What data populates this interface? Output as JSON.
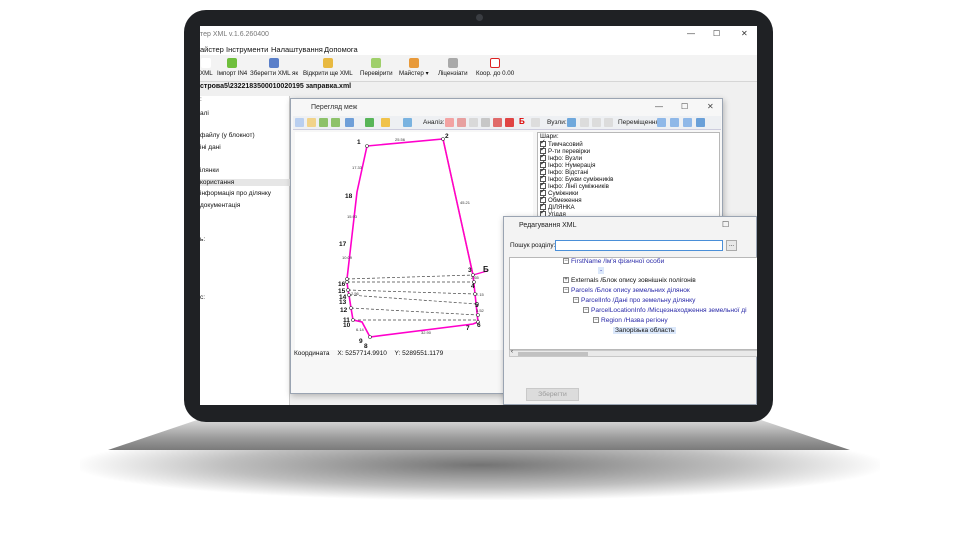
{
  "app": {
    "title": "тер XML v.1.6.260400",
    "menu": [
      "айстер",
      "Інструменти",
      "Налаштування",
      "Допомога"
    ],
    "toolbar": [
      "XML",
      "Імпорт IN4",
      "Зберегти XML як",
      "Відкрити ще XML",
      "Перевірити",
      "Майстер",
      "Ліцензіати",
      "Коор. до 0.00"
    ],
    "path": "строва5\\2322183500010020195 заправка.xml",
    "left_items": [
      ":",
      "алі",
      "файлу (у блокнот)",
      "іні дані",
      "ілянки",
      "користання",
      "інформація про ділянку",
      "документація",
      "ь:",
      "с:"
    ]
  },
  "map_window": {
    "title": "Перегляд меж",
    "analysis_label": "Аналіз:",
    "nodes_label": "Вузли:",
    "moves_label": "Переміщення:",
    "layers_header": "Шари:",
    "layers": [
      "Тимчасовий",
      "Р-ти перевірки",
      "Інфо: Вузли",
      "Інфо: Нумерація",
      "Інфо: Відстані",
      "Інфо: Букви суміжників",
      "Інфо: Лінії суміжників",
      "Суміжники",
      "Обмеження",
      "ДІЛЯНКА",
      "Угіддя"
    ],
    "coord_label": "Координата",
    "coord_x": "X: 5257714.9910",
    "coord_y": "Y: 5289551.1179",
    "point_labels": [
      "1",
      "2",
      "18",
      "17",
      "16",
      "15",
      "14",
      "13",
      "12",
      "11",
      "10",
      "9",
      "8",
      "7",
      "6",
      "5",
      "4",
      "3",
      "Б"
    ],
    "distance_labels": [
      "25.56",
      "17.33",
      "15.93",
      "45.21",
      "10.09",
      "7.15",
      "3.52",
      "32.90",
      "6.14",
      "2.56",
      "2.65"
    ]
  },
  "xml_window": {
    "title": "Редагування XML",
    "search_label": "Пошук розділу:",
    "search_value": "",
    "dots": "...",
    "tree": [
      "FirstName /Ім'я фізичної особи",
      "-",
      "Externals /Блок опису зовнішніх полігонів",
      "Parcels /Блок опису земельних ділянок",
      "ParcelInfo /Дані про земельну ділянку",
      "ParcelLocationInfo /Місцезнаходження земельної ді",
      "Region /Назва регіону",
      "Запорізька область"
    ],
    "save_label": "Зберегти"
  },
  "colors": {
    "parcel_line": "#ff00cc",
    "neighbor_line": "#f2c200",
    "dashed_line": "#444444",
    "selection": "#dbe8fb",
    "tree_blue": "#2a2aa8"
  }
}
